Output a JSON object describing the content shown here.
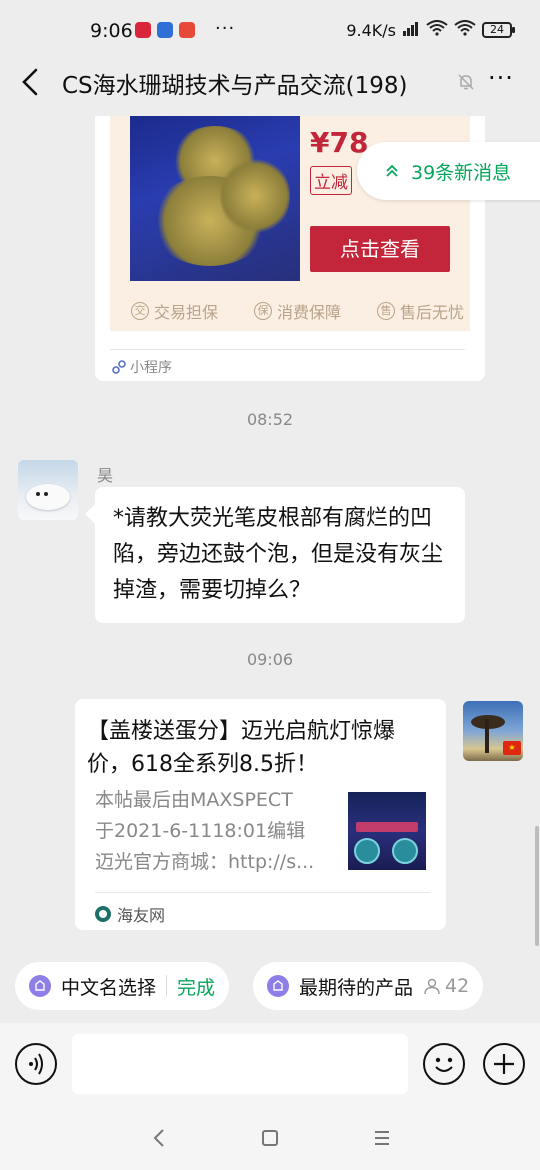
{
  "status_bar": {
    "time": "9:06",
    "more": "···",
    "network_speed": "9.4K/s",
    "battery": "24"
  },
  "header": {
    "title": "CS海水珊瑚技术与产品交流(198)",
    "more": "···"
  },
  "mini_program_card": {
    "price": "¥78",
    "badge": "立减",
    "button": "点击查看",
    "guarantees": [
      {
        "icon": "交",
        "label": "交易担保"
      },
      {
        "icon": "保",
        "label": "消费保障"
      },
      {
        "icon": "售",
        "label": "售后无忧"
      }
    ],
    "source_label": "小程序"
  },
  "new_messages_pill": "39条新消息",
  "timestamps": {
    "first": "08:52",
    "second": "09:06"
  },
  "message_left": {
    "sender": "昊",
    "text": "*请教大荧光笔皮根部有腐烂的凹陷，旁边还鼓个泡，但是没有灰尘掉渣，需要切掉么？"
  },
  "link_card": {
    "title": "【盖楼送蛋分】迈光启航灯惊爆价，618全系列8.5折！",
    "description": "本帖最后由MAXSPECT\n于2021-6-1118:01编辑\n迈光官方商城：http://s...",
    "source": "海友网"
  },
  "quick_replies": {
    "chip1_label": "中文名选择",
    "chip1_done": "完成",
    "chip2_label": "最期待的产品",
    "chip2_count": "42"
  },
  "input": {
    "placeholder": ""
  },
  "colors": {
    "accent_green": "#07a65a",
    "price_red": "#c3263a",
    "background": "#ededed"
  }
}
